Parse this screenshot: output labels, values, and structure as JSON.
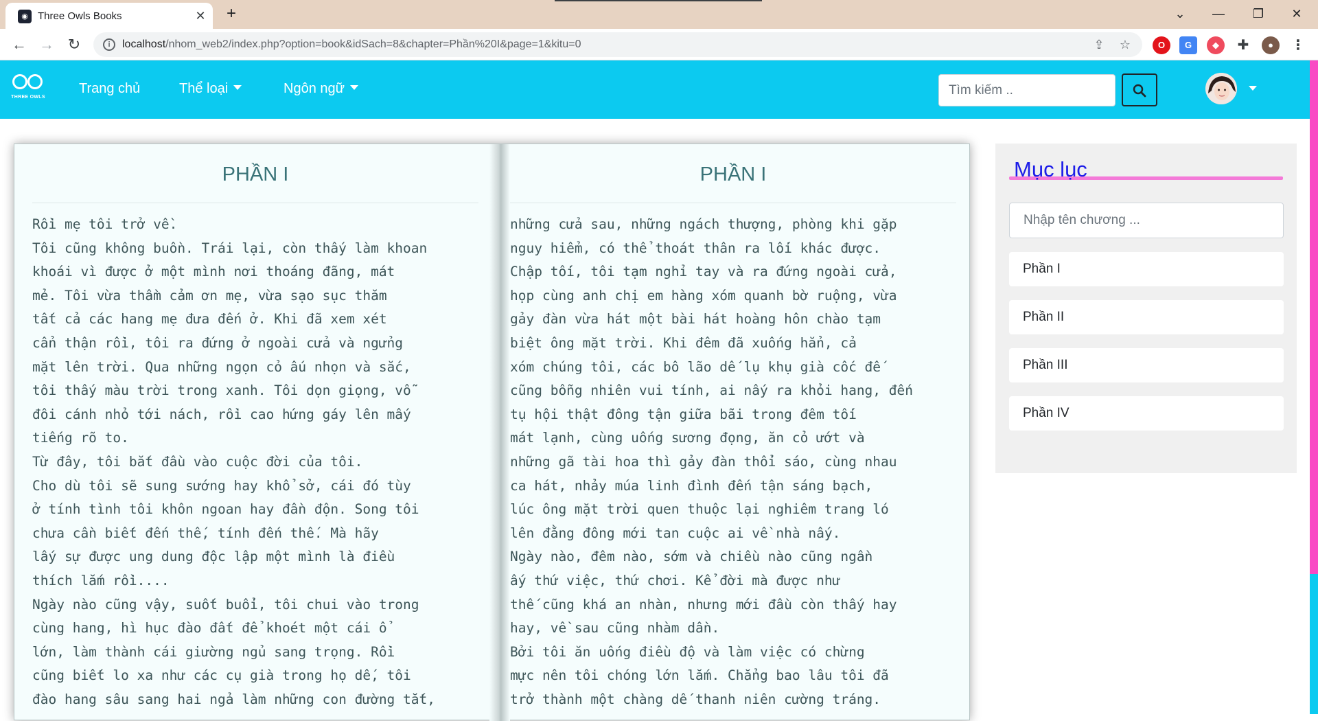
{
  "browser": {
    "tab_title": "Three Owls Books",
    "tab_favicon": "owl-favicon",
    "url_host": "localhost",
    "url_path": "/nhom_web2/index.php?option=book&idSach=8&chapter=Phần%20I&page=1&kitu=0"
  },
  "navbar": {
    "logo_text": "THREE OWLS",
    "links": [
      "Trang chủ",
      "Thể loại",
      "Ngôn ngữ"
    ],
    "search_placeholder": "Tìm kiếm ..",
    "accent_color": "#0ccaf0"
  },
  "book": {
    "left_page": {
      "title": "PHẦN I",
      "text": "Rồi mẹ tôi trở về.\nTôi cũng không buồn. Trái lại, còn thấy làm khoan\nkhoái vì được ở một mình nơi thoáng đãng, mát\nmẻ. Tôi vừa thầm cảm ơn mẹ, vừa sạo sục thăm\ntất cả các hang mẹ đưa đến ở. Khi đã xem xét\ncẩn thận rồi, tôi ra đứng ở ngoài cửa và ngửng\nmặt lên trời. Qua những ngọn cỏ ấu nhọn và sắc,\ntôi thấy màu trời trong xanh. Tôi dọn giọng, vỗ\nđôi cánh nhỏ tới nách, rồi cao hứng gáy lên mấy\ntiếng rõ to.\nTừ đây, tôi bắt đầu vào cuộc đời của tôi.\nCho dù tôi sẽ sung sướng hay khổ sở, cái đó tùy\nở tính tình tôi khôn ngoan hay đần độn. Song tôi\nchưa cần biết đến thế, tính đến thế. Mà hãy\nlấy sự được ung dung độc lập một mình là điều\nthích lắm rồi....\nNgày nào cũng vậy, suốt buổi, tôi chui vào trong\ncùng hang, hì hục đào đất để khoét một cái ổ\nlớn, làm thành cái giường ngủ sang trọng. Rồi\ncũng biết lo xa như các cụ già trong họ dế, tôi\nđào hang sâu sang hai ngả làm những con đường tắt,"
    },
    "right_page": {
      "title": "PHẦN I",
      "text": "những cửa sau, những ngách thượng, phòng khi gặp\nnguy hiểm, có thể thoát thân ra lối khác được.\nChập tối, tôi tạm nghỉ tay và ra đứng ngoài cửa,\nhọp cùng anh chị em hàng xóm quanh bờ ruộng, vừa\ngảy đàn vừa hát một bài hát hoàng hôn chào tạm\nbiệt ông mặt trời. Khi đêm đã xuống hẳn, cả\nxóm chúng tôi, các bô lão dế lụ khụ già cốc đế\ncũng bỗng nhiên vui tính, ai nấy ra khỏi hang, đến\ntụ hội thật đông tận giữa bãi trong đêm tối\nmát lạnh, cùng uống sương đọng, ăn cỏ ướt và\nnhững gã tài hoa thì gảy đàn thổi sáo, cùng nhau\nca hát, nhảy múa linh đình đến tận sáng bạch,\nlúc ông mặt trời quen thuộc lại nghiêm trang ló\nlên đằng đông mới tan cuộc ai về nhà nấy.\nNgày nào, đêm nào, sớm và chiều nào cũng ngần\nấy thứ việc, thứ chơi. Kể đời mà được như\nthế cũng khá an nhàn, nhưng mới đầu còn thấy hay\nhay, về sau cũng nhàm dần.\nBởi tôi ăn uống điều độ và làm việc có chừng\nmực nên tôi chóng lớn lắm. Chẳng bao lâu tôi đã\ntrở thành một chàng dế thanh niên cường tráng."
    }
  },
  "toc": {
    "title": "Mục lục",
    "search_placeholder": "Nhập tên chương ...",
    "chapters": [
      "Phần I",
      "Phần II",
      "Phần III",
      "Phần IV"
    ],
    "title_color": "#1d1de8",
    "underline_color": "#f47ad8"
  }
}
